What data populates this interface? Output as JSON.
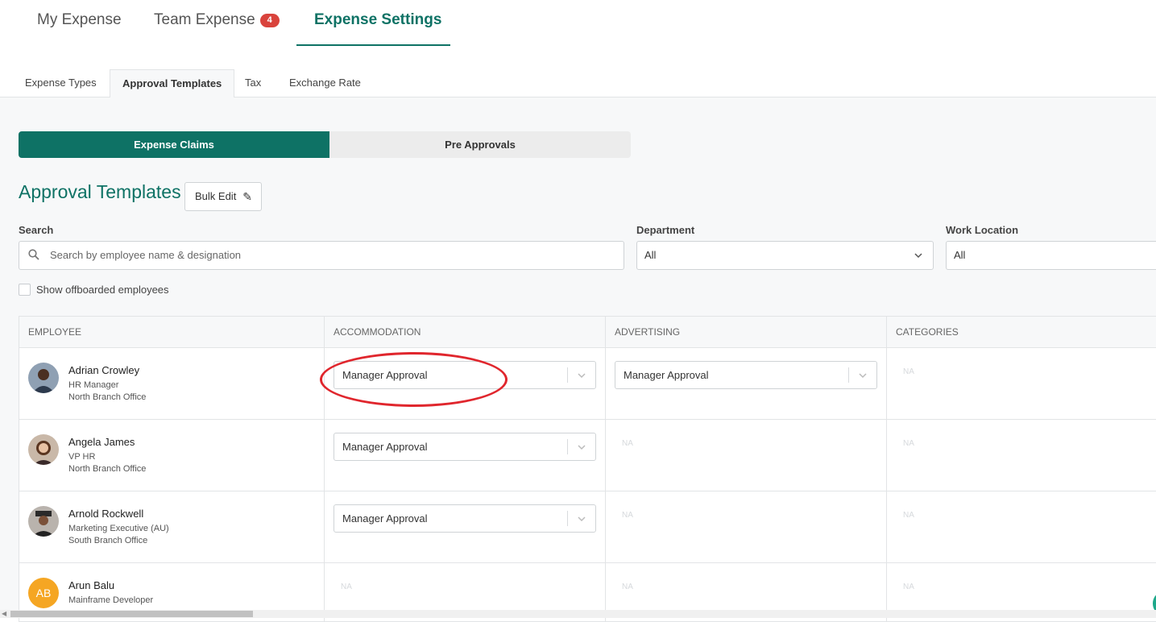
{
  "top_tabs": {
    "my_expense": "My Expense",
    "team_expense": "Team Expense",
    "team_badge": "4",
    "expense_settings": "Expense Settings"
  },
  "sub_tabs": {
    "expense_types": "Expense Types",
    "approval_templates": "Approval Templates",
    "tax": "Tax",
    "exchange_rate": "Exchange Rate"
  },
  "segment": {
    "expense_claims": "Expense Claims",
    "pre_approvals": "Pre Approvals"
  },
  "page_title": "Approval Templates",
  "bulk_edit_label": "Bulk Edit",
  "filters": {
    "search_label": "Search",
    "search_placeholder": "Search by employee name & designation",
    "department_label": "Department",
    "department_value": "All",
    "location_label": "Work Location",
    "location_value": "All",
    "offboarded_label": "Show offboarded employees"
  },
  "table": {
    "headers": [
      "EMPLOYEE",
      "ACCOMMODATION",
      "ADVERTISING",
      "CATEGORIES"
    ],
    "rows": [
      {
        "name": "Adrian Crowley",
        "title": "HR Manager",
        "office": "North Branch Office",
        "accommodation": "Manager Approval",
        "advertising": "Manager Approval",
        "categories": "NA"
      },
      {
        "name": "Angela James",
        "title": "VP HR",
        "office": "North Branch Office",
        "accommodation": "Manager Approval",
        "advertising": "NA",
        "categories": "NA"
      },
      {
        "name": "Arnold Rockwell",
        "title": "Marketing Executive (AU)",
        "office": "South Branch Office",
        "accommodation": "Manager Approval",
        "advertising": "NA",
        "categories": "NA"
      },
      {
        "name": "Arun Balu",
        "initials": "AB",
        "title": "Mainframe Developer",
        "accommodation": "NA",
        "advertising": "NA",
        "categories": "NA"
      }
    ]
  },
  "colors": {
    "brand": "#0e7265",
    "badge": "#d9433c",
    "annotation": "#e0262d",
    "initials_avatar": "#f5a623"
  }
}
